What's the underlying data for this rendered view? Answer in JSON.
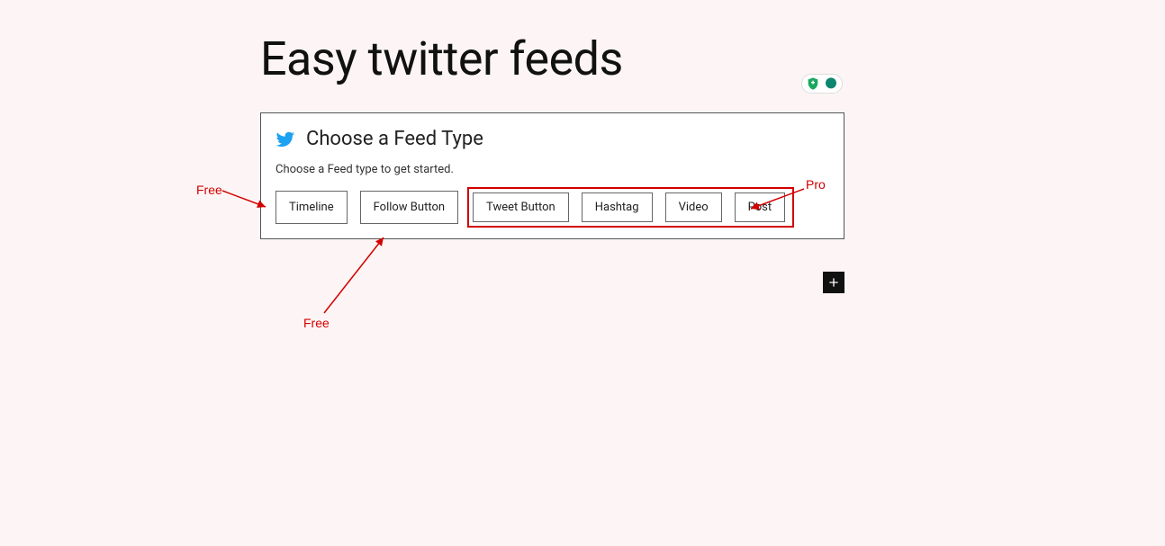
{
  "header": {
    "title": "Easy twitter feeds"
  },
  "panel": {
    "title": "Choose a Feed Type",
    "subtitle": "Choose a Feed type to get started.",
    "buttons": {
      "free": [
        "Timeline",
        "Follow Button"
      ],
      "pro": [
        "Tweet Button",
        "Hashtag",
        "Video",
        "Post"
      ]
    }
  },
  "annotations": {
    "free1": "Free",
    "free2": "Free",
    "pro": "Pro"
  },
  "buttons": {
    "addBlock": "add-block"
  }
}
